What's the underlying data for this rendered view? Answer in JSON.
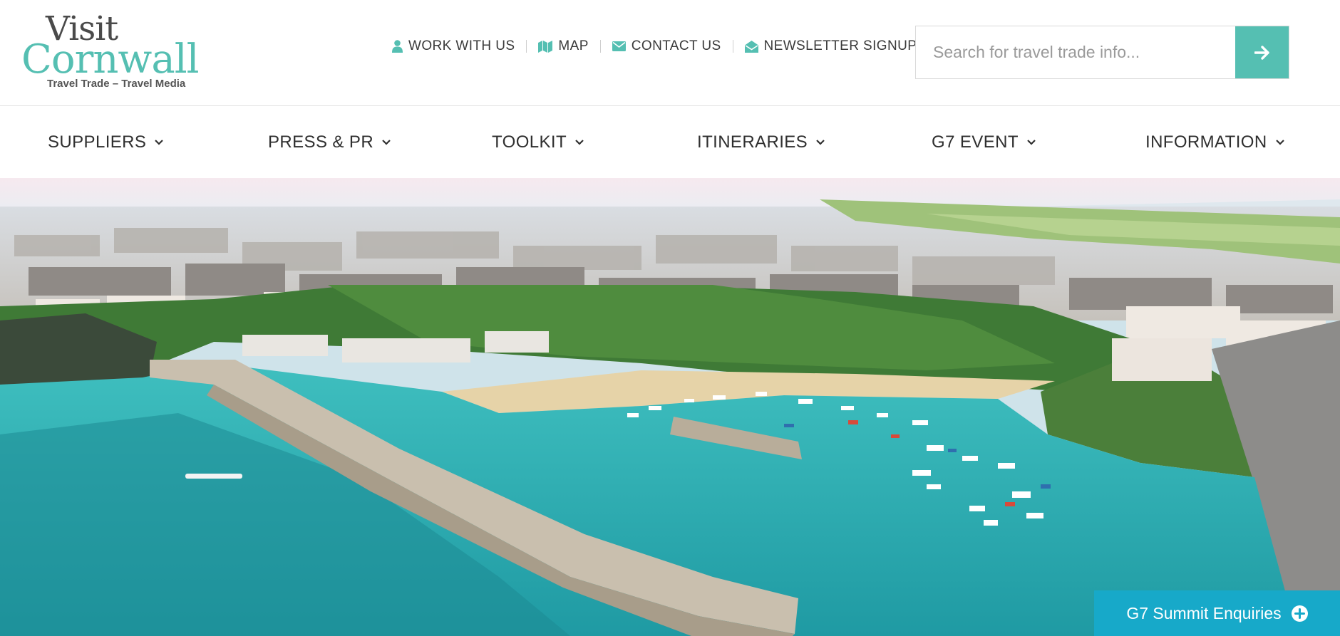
{
  "brand": {
    "logo_line1": "Visit",
    "logo_line2": "Cornwall",
    "tagline": "Travel Trade – Travel Media",
    "accent_color": "#55bfb2",
    "cta_color": "#17a9c9"
  },
  "utility_nav": [
    {
      "label": "WORK WITH US",
      "icon": "person-icon"
    },
    {
      "label": "MAP",
      "icon": "map-icon"
    },
    {
      "label": "CONTACT US",
      "icon": "envelope-icon"
    },
    {
      "label": "NEWSLETTER SIGNUP",
      "icon": "envelope-open-icon"
    }
  ],
  "search": {
    "placeholder": "Search for travel trade info...",
    "value": "",
    "button_icon": "arrow-right-icon"
  },
  "main_nav": [
    {
      "label": "SUPPLIERS"
    },
    {
      "label": "PRESS & PR"
    },
    {
      "label": "TOOLKIT"
    },
    {
      "label": "ITINERARIES"
    },
    {
      "label": "G7 EVENT"
    },
    {
      "label": "INFORMATION"
    }
  ],
  "hero": {
    "image": "aerial-harbour-photo"
  },
  "cta": {
    "label": "G7 Summit Enquiries",
    "icon": "plus-circle-icon"
  }
}
